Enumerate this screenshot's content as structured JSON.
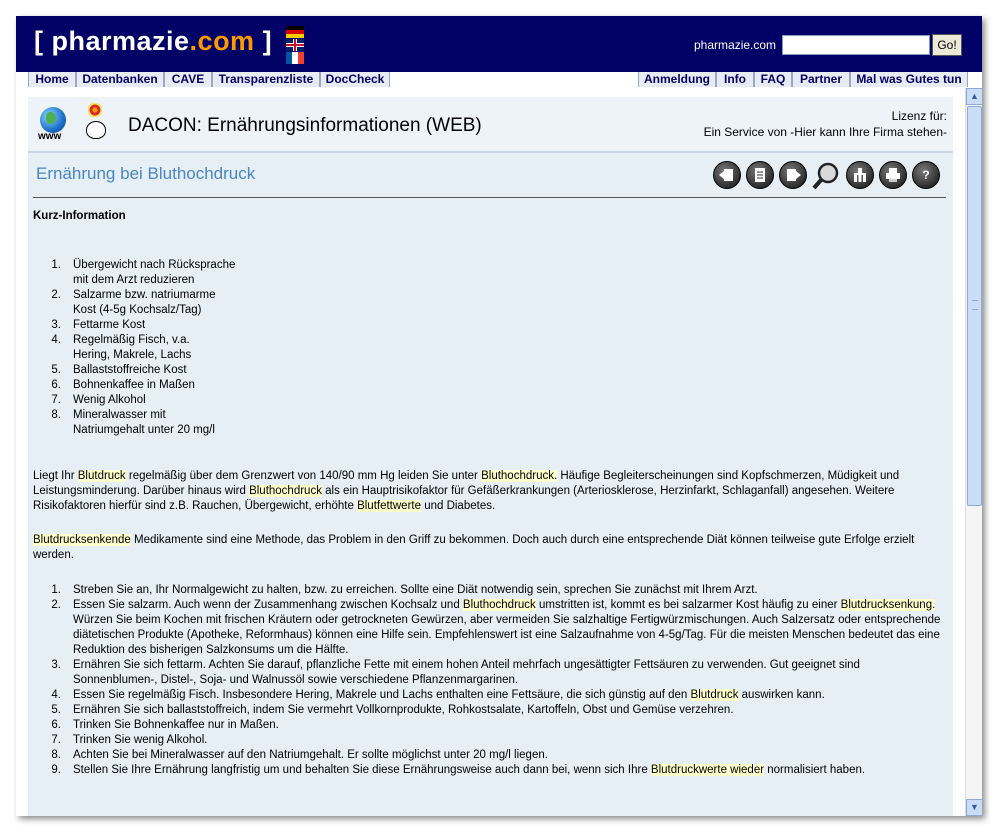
{
  "site": {
    "logo_open": "[ pharmazie",
    "logo_dom": ".com",
    "logo_close": " ]"
  },
  "search": {
    "label": "pharmazie.com",
    "value": "",
    "button": "Go!"
  },
  "nav_left": [
    "Home",
    "Datenbanken",
    "CAVE",
    "Transparenzliste",
    "DocCheck"
  ],
  "nav_right": [
    "Anmeldung",
    "Info",
    "FAQ",
    "Partner",
    "Mal was Gutes tun"
  ],
  "header": {
    "www": "www",
    "title": "DACON: Ernährungsinformationen (WEB)",
    "license_label": "Lizenz für:",
    "license_text": "Ein Service von -Hier kann Ihre Firma stehen-"
  },
  "section_title": "Ernährung bei Bluthochdruck",
  "toolbar_icons": [
    "back-icon",
    "document-icon",
    "forward-icon",
    "search-icon",
    "tree-icon",
    "print-icon",
    "help-icon"
  ],
  "toolbar_help_glyph": "?",
  "kurz": {
    "title": "Kurz-Information",
    "items": [
      {
        "n": "1.",
        "l1": "Übergewicht nach Rücksprache",
        "l2": "mit dem Arzt reduzieren"
      },
      {
        "n": "2.",
        "l1": "Salzarme bzw. natriumarme",
        "l2": "Kost (4-5g Kochsalz/Tag)"
      },
      {
        "n": "3.",
        "l1": "Fettarme Kost",
        "l2": ""
      },
      {
        "n": "4.",
        "l1": "Regelmäßig Fisch, v.a.",
        "l2": "Hering, Makrele, Lachs"
      },
      {
        "n": "5.",
        "l1": "Ballaststoffreiche Kost",
        "l2": ""
      },
      {
        "n": "6.",
        "l1": "Bohnenkaffee in Maßen",
        "l2": ""
      },
      {
        "n": "7.",
        "l1": "Wenig Alkohol",
        "l2": ""
      },
      {
        "n": "8.",
        "l1": "Mineralwasser mit",
        "l2": "Natriumgehalt unter 20 mg/l"
      }
    ]
  },
  "para1": {
    "t1": "Liegt Ihr ",
    "m1": "Blutdruck",
    "t2": " regelmäßig über dem Grenzwert von 140/90 mm Hg leiden Sie unter ",
    "m2": "Bluthochdruck.",
    "t3": " Häufige Begleiterscheinungen sind Kopfschmerzen, Müdigkeit und Leistungsminderung. Darüber hinaus wird ",
    "m3": "Bluthochdruck",
    "t4": " als ein Hauptrisikofaktor für Gefäßerkrankungen  (Arteriosklerose, Herzinfarkt, Schlaganfall) angesehen. Weitere Risikofaktoren hierfür sind z.B. Rauchen, Übergewicht, erhöhte ",
    "m4": "Blutfettwerte",
    "t5": " und Diabetes."
  },
  "para2": {
    "m1": "Blutdrucksenkende",
    "t1": " Medikamente sind eine Methode, das Problem in den Griff zu bekommen. Doch auch durch eine entsprechende Diät können teilweise gute Erfolge erzielt werden."
  },
  "main_list": [
    {
      "n": "1.",
      "a": "Streben Sie an, Ihr Normalgewicht zu halten, bzw. zu erreichen. Sollte eine Diät notwendig sein, sprechen Sie zunächst mit Ihrem Arzt.",
      "m": "",
      "b": "",
      "m2": "",
      "c": ""
    },
    {
      "n": "2.",
      "a": "Essen Sie salzarm. Auch wenn der Zusammenhang zwischen Kochsalz und ",
      "m": "Bluthochdruck",
      "b": " umstritten ist, kommt es bei salzarmer Kost häufig zu einer ",
      "m2": "Blutdrucksenkung.",
      "c": " Würzen Sie beim Kochen mit frischen Kräutern oder getrockneten Gewürzen, aber vermeiden Sie salzhaltige Fertigwürzmischungen. Auch Salzersatz oder entsprechende diätetischen Produkte (Apotheke, Reformhaus) können eine Hilfe sein. Empfehlenswert ist eine Salzaufnahme von 4-5g/Tag. Für die meisten Menschen bedeutet das eine Reduktion des bisherigen Salzkonsums um die Hälfte."
    },
    {
      "n": "3.",
      "a": "Ernähren Sie sich fettarm. Achten Sie darauf, pflanzliche Fette mit einem hohen Anteil mehrfach ungesättigter Fettsäuren zu verwenden. Gut geeignet sind Sonnenblumen-, Distel-, Soja- und Walnussöl sowie verschiedene Pflanzenmargarinen.",
      "m": "",
      "b": "",
      "m2": "",
      "c": ""
    },
    {
      "n": "4.",
      "a": "Essen Sie regelmäßig Fisch. Insbesondere Hering, Makrele und Lachs enthalten eine Fettsäure, die sich günstig auf den ",
      "m": "Blutdruck",
      "b": " auswirken kann.",
      "m2": "",
      "c": ""
    },
    {
      "n": "5.",
      "a": "Ernähren Sie sich ballaststoffreich, indem Sie vermehrt Vollkornprodukte, Rohkostsalate, Kartoffeln, Obst und Gemüse verzehren.",
      "m": "",
      "b": "",
      "m2": "",
      "c": ""
    },
    {
      "n": "6.",
      "a": "Trinken Sie Bohnenkaffee nur in Maßen.",
      "m": "",
      "b": "",
      "m2": "",
      "c": ""
    },
    {
      "n": "7.",
      "a": "Trinken Sie wenig Alkohol.",
      "m": "",
      "b": "",
      "m2": "",
      "c": ""
    },
    {
      "n": "8.",
      "a": "Achten Sie bei Mineralwasser auf den Natriumgehalt. Er sollte möglichst unter 20 mg/l liegen.",
      "m": "",
      "b": "",
      "m2": "",
      "c": ""
    },
    {
      "n": "9.",
      "a": "Stellen Sie Ihre Ernährung langfristig um und behalten Sie diese Ernährungsweise auch dann bei, wenn sich Ihre ",
      "m": "Blutdruckwerte wieder",
      "b": " normalisiert haben.",
      "m2": "",
      "c": ""
    }
  ],
  "colors": {
    "topbar": "#010066",
    "accent": "#ff9900",
    "section_title": "#4a86c2",
    "highlight": "#ffffcc"
  }
}
